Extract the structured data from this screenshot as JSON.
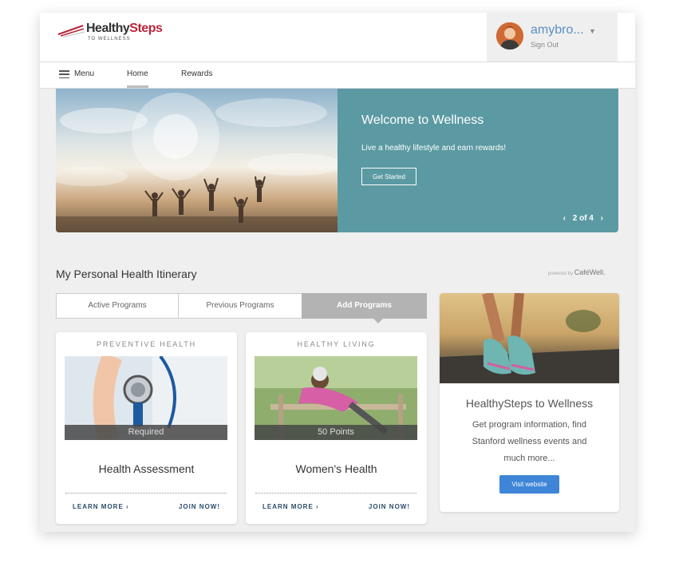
{
  "header": {
    "logo_text_a": "Healthy",
    "logo_text_b": "Steps",
    "logo_tagline": "TO WELLNESS",
    "username": "amybro...",
    "signout": "Sign Out"
  },
  "nav": {
    "menu_label": "Menu",
    "home_label": "Home",
    "rewards_label": "Rewards"
  },
  "hero": {
    "title": "Welcome to Wellness",
    "subtitle": "Live a healthy lifestyle and earn rewards!",
    "button": "Get Started",
    "pager": "2 of 4"
  },
  "section": {
    "title": "My Personal Health Itinerary",
    "powered_by": "powered by",
    "powered_brand": "CaféWell."
  },
  "tabs": [
    {
      "label": "Active Programs"
    },
    {
      "label": "Previous Programs"
    },
    {
      "label": "Add Programs"
    }
  ],
  "cards": [
    {
      "category": "PREVENTIVE HEALTH",
      "badge": "Required",
      "title": "Health Assessment",
      "learn": "LEARN MORE",
      "join": "JOIN NOW!"
    },
    {
      "category": "HEALTHY LIVING",
      "badge": "50 Points",
      "title": "Women's Health",
      "learn": "LEARN MORE",
      "join": "JOIN NOW!"
    }
  ],
  "promo": {
    "title": "HealthySteps to Wellness",
    "text": "Get program information, find Stanford wellness events and much more...",
    "button": "Visit website"
  },
  "colors": {
    "brand_red": "#b8263a",
    "hero_teal": "#5b9aa2",
    "link_blue": "#5b8ec5",
    "button_blue": "#3e85d8"
  }
}
